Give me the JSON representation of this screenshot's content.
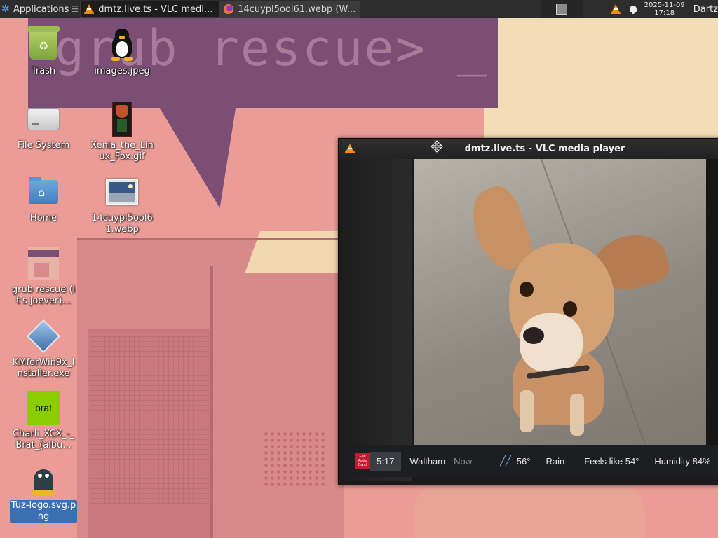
{
  "panel": {
    "applications_label": "Applications",
    "tasks": [
      {
        "label": "dmtz.live.ts - VLC medi...",
        "icon": "vlc-icon"
      },
      {
        "label": "14cuypl5ool61.webp (W...",
        "icon": "image-viewer-icon"
      }
    ],
    "clock_date": "2025-11-09",
    "clock_time": "17:18",
    "user": "Dartz"
  },
  "desktop": {
    "icons": [
      {
        "label": "Trash"
      },
      {
        "label": "images.jpeg"
      },
      {
        "label": "File System"
      },
      {
        "label": "Xenia_the_Linux_Fox.gif"
      },
      {
        "label": "Home"
      },
      {
        "label": "14cuypl5ool61.webp"
      },
      {
        "label": "grub rescue (it's joever)..."
      },
      {
        "label": "KMforWin9x_Installer.exe"
      },
      {
        "label": "Charli_XCX_-_Brat_(albu..."
      },
      {
        "label": "Tuz-logo.svg.png"
      }
    ],
    "brat_text": "brat"
  },
  "wallpaper": {
    "text": "grub rescue> _"
  },
  "vlc": {
    "title": "dmtz.live.ts - VLC media player",
    "ticker": {
      "station": "Earl Audio Band",
      "time": "5:17",
      "city": "Waltham",
      "now": "Now",
      "temp": "56°",
      "condition": "Rain",
      "feels": "Feels like 54°",
      "humidity": "Humidity 84%"
    }
  },
  "colors": {
    "panel_bg": "#2d2d2d",
    "vlc_orange": "#f58a12",
    "selection": "#3c6eb4",
    "brat_green": "#8ace00"
  }
}
